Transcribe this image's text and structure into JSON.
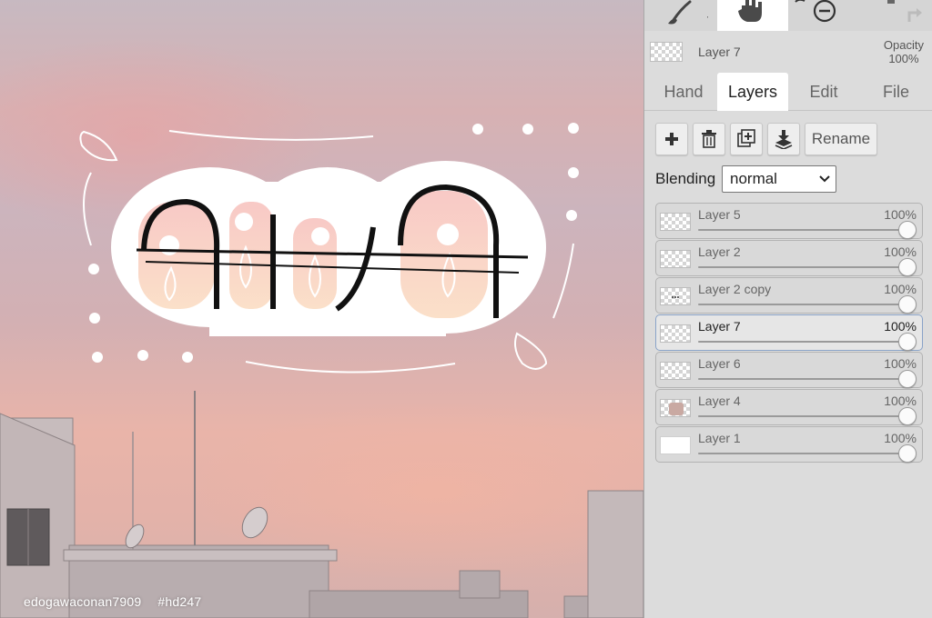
{
  "watermark": {
    "author": "edogawaconan7909",
    "tag": "#hd247"
  },
  "toolbar": {
    "tools": [
      {
        "name": "brush-tool",
        "icon": "brush-icon"
      },
      {
        "name": "hand-tool",
        "icon": "hand-icon",
        "selected": true
      },
      {
        "name": "zoom-tool",
        "icon": "zoom-out-icon"
      },
      {
        "name": "redo-tool",
        "icon": "redo-icon"
      }
    ]
  },
  "current_layer": {
    "name": "Layer 7",
    "opacity_label": "Opacity",
    "opacity_value": "100%"
  },
  "tabs": [
    {
      "label": "Hand",
      "active": false
    },
    {
      "label": "Layers",
      "active": true
    },
    {
      "label": "Edit",
      "active": false
    },
    {
      "label": "File",
      "active": false
    }
  ],
  "actions": {
    "add_icon": "plus-icon",
    "delete_icon": "trash-icon",
    "duplicate_icon": "duplicate-icon",
    "merge_icon": "merge-down-icon",
    "rename_label": "Rename"
  },
  "blending": {
    "label": "Blending",
    "value": "normal"
  },
  "layers": [
    {
      "name": "Layer 5",
      "opacity": "100%",
      "opacity_fraction": 1.0,
      "active": false,
      "thumb": "transparent"
    },
    {
      "name": "Layer 2",
      "opacity": "100%",
      "opacity_fraction": 1.0,
      "active": false,
      "thumb": "transparent"
    },
    {
      "name": "Layer 2 copy",
      "opacity": "100%",
      "opacity_fraction": 1.0,
      "active": false,
      "thumb": "transparent-dots"
    },
    {
      "name": "Layer 7",
      "opacity": "100%",
      "opacity_fraction": 1.0,
      "active": true,
      "thumb": "transparent"
    },
    {
      "name": "Layer 6",
      "opacity": "100%",
      "opacity_fraction": 1.0,
      "active": false,
      "thumb": "transparent"
    },
    {
      "name": "Layer 4",
      "opacity": "100%",
      "opacity_fraction": 1.0,
      "active": false,
      "thumb": "photo"
    },
    {
      "name": "Layer 1",
      "opacity": "100%",
      "opacity_fraction": 1.0,
      "active": false,
      "thumb": "white"
    }
  ],
  "colors": {
    "accent_border": "#8aa3c8",
    "sky_pink": "#e9b4a9",
    "panel_bg": "#dcdcdc"
  }
}
